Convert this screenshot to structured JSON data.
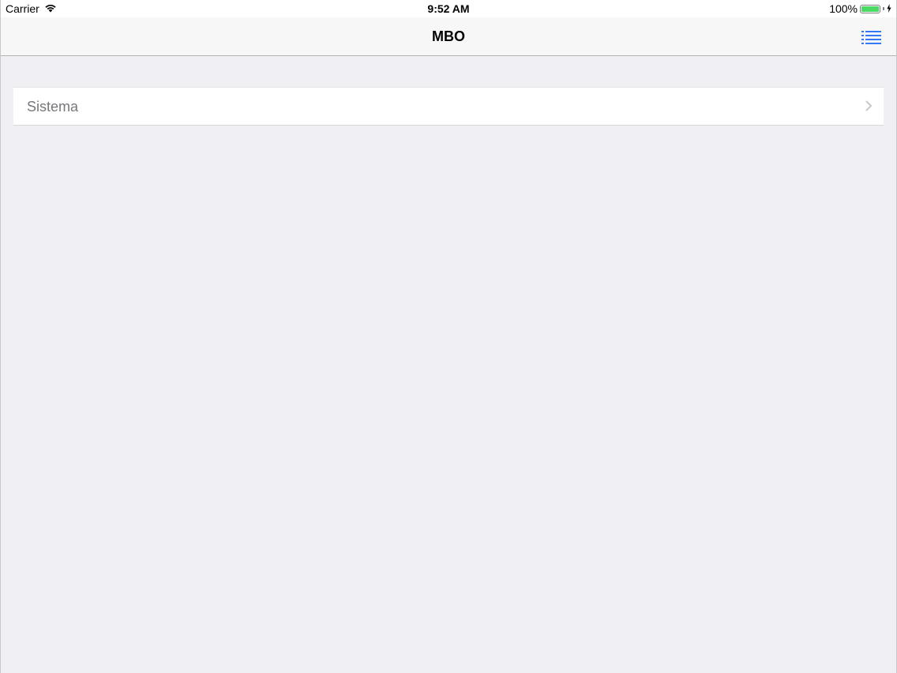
{
  "status_bar": {
    "carrier": "Carrier",
    "time": "9:52 AM",
    "battery": "100%",
    "icons": [
      "wifi-icon",
      "battery-icon",
      "charging-bolt-icon"
    ]
  },
  "nav": {
    "title": "MBO",
    "right_button_icon": "list-menu-icon"
  },
  "menu": {
    "items": [
      {
        "label": "Sistema",
        "accessory": "chevron-right-icon"
      }
    ]
  },
  "colors": {
    "tint": "#3478f6",
    "background": "#efeff4",
    "battery": "#4cd964"
  }
}
